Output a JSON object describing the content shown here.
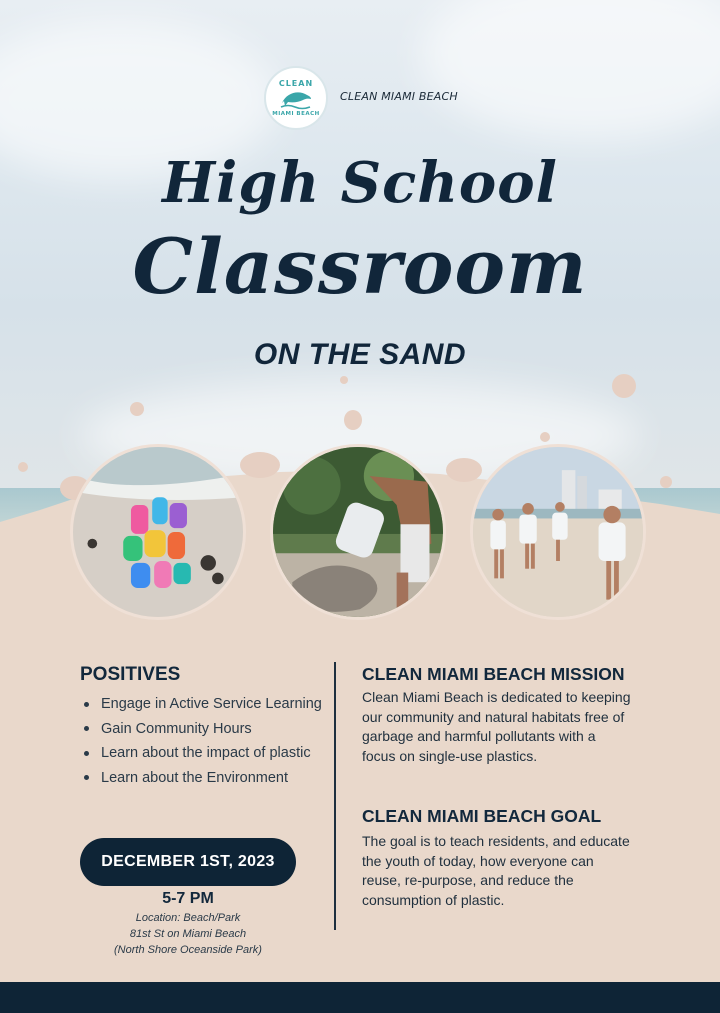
{
  "brand": {
    "name": "CLEAN MIAMI BEACH",
    "logo_top_text": "CLEAN",
    "logo_bottom_text": "MIAMI BEACH"
  },
  "title": {
    "line1": "High School",
    "line2": "Classroom",
    "subtitle": "ON THE SAND"
  },
  "photos": [
    {
      "icon": "plastic-waste-on-sand-photo"
    },
    {
      "icon": "volunteers-collecting-trash-photo"
    },
    {
      "icon": "volunteers-walking-beach-photo"
    }
  ],
  "positives": {
    "heading": "POSITIVES",
    "items": [
      "Engage in Active Service Learning",
      "Gain Community Hours",
      "Learn about the impact of plastic",
      "Learn about the Environment"
    ]
  },
  "mission": {
    "heading": "CLEAN MIAMI BEACH MISSION",
    "body": "Clean Miami Beach is dedicated to keeping our community and natural habitats free of garbage and harmful pollutants with a focus on single-use plastics."
  },
  "goal": {
    "heading": "CLEAN MIAMI BEACH GOAL",
    "body": "The goal is to teach residents, and educate the youth of today, how everyone can reuse, re-purpose, and reduce the consumption of plastic."
  },
  "event": {
    "date": "DECEMBER 1ST, 2023",
    "time": "5-7 PM",
    "location_line1": "Location: Beach/Park",
    "location_line2": "81st St on Miami Beach",
    "location_line3": "(North Shore Oceanside Park)"
  },
  "colors": {
    "navy": "#0e2436",
    "sand": "#e9d8cb",
    "logo_teal": "#3aa6a9"
  }
}
